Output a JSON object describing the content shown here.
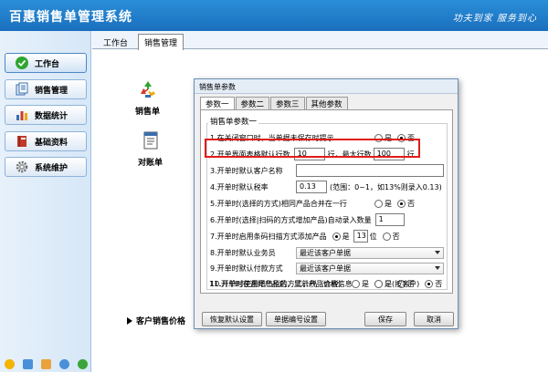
{
  "app": {
    "title": "百惠销售单管理系统",
    "slogan": "功夫到家  服务到心"
  },
  "sidebar": {
    "items": [
      {
        "label": "工作台",
        "icon": "check-circle-icon",
        "color": "#2fa52f"
      },
      {
        "label": "销售管理",
        "icon": "documents-icon",
        "color": "#3a6fb0"
      },
      {
        "label": "数据统计",
        "icon": "bar-chart-icon",
        "color": "#d23a2a"
      },
      {
        "label": "基础资料",
        "icon": "book-icon",
        "color": "#c0392b"
      },
      {
        "label": "系统维护",
        "icon": "gear-icon",
        "color": "#707070"
      }
    ],
    "status_icons": [
      {
        "name": "warning-status-icon",
        "color": "#f4b400"
      },
      {
        "name": "note-status-icon",
        "color": "#4a90d9"
      },
      {
        "name": "folder-status-icon",
        "color": "#e8a33d"
      },
      {
        "name": "info-status-icon",
        "color": "#4a90d9"
      },
      {
        "name": "refresh-status-icon",
        "color": "#3aa53a"
      }
    ]
  },
  "tabs": [
    {
      "label": "工作台"
    },
    {
      "label": "销售管理"
    }
  ],
  "workspace": {
    "modules": [
      {
        "label": "销售单",
        "icon": "recycle-icon"
      },
      {
        "label": "对账单",
        "icon": "ledger-icon"
      }
    ],
    "price_link": "客户销售价格"
  },
  "dialog": {
    "title": "销售单参数",
    "tabs": [
      "参数一",
      "参数二",
      "参数三",
      "其他参数"
    ],
    "group_label": "销售单参数一",
    "rows": {
      "r1": {
        "label": "1.在关闭窗口时，当单据未保存时提示",
        "opt_yes": "是",
        "opt_no": "否",
        "selected": "否"
      },
      "r2": {
        "label": "2.开单界面表格默认行数",
        "value": "10",
        "unit": "行，最大行数",
        "max_value": "100",
        "max_unit": "行"
      },
      "r3": {
        "label": "3.开单时默认客户名称",
        "value": ""
      },
      "r4": {
        "label": "4.开单时默认税率",
        "value": "0.13",
        "hint": "(范围：0~1，如13%则录入0.13)"
      },
      "r5": {
        "label": "5.开单时(选择的方式)相同产品合并在一行",
        "opt_yes": "是",
        "opt_no": "否",
        "selected": "否"
      },
      "r6": {
        "label": "6.开单时(选择|扫码的方式增加产品)自动录入数量",
        "value": "1"
      },
      "r7": {
        "label": "7.开单时启用条码扫描方式添加产品",
        "opt_yes": "是",
        "digits": "13",
        "digits_unit": "位",
        "opt_no": "否",
        "selected": "是"
      },
      "r8": {
        "label": "8.开单时默认业务员",
        "value": "最近该客户单据"
      },
      "r9": {
        "label": "9.开单时默认付款方式",
        "value": "最近该客户单据"
      },
      "r10": {
        "label": "10.开单时使用增值税的方式计税（含税）",
        "opt_yes": "是",
        "opt_no": "否",
        "selected": "是"
      },
      "r11": {
        "label": "11.开单时在选择产品后，显示产品价格信息",
        "opt_yes": "是",
        "opt_mid": "是(按客户)",
        "opt_no": "否",
        "selected": "否"
      }
    },
    "buttons": {
      "restore": "恢复默认设置",
      "numbering": "单据编号设置",
      "save": "保存",
      "cancel": "取消"
    }
  },
  "colors": {
    "titlebar": "#1a6fbd",
    "highlight": "#e01b1b"
  }
}
